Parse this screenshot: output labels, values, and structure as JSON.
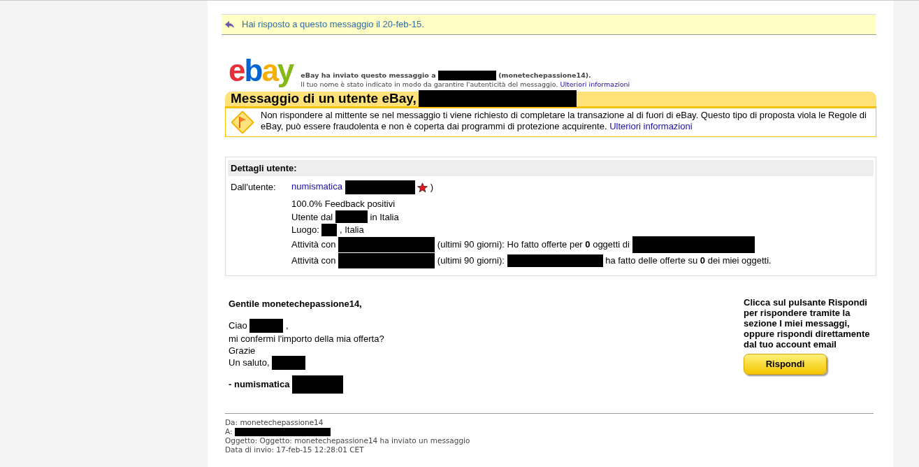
{
  "reply_notice": {
    "text": "Hai risposto a questo messaggio il 20-feb-15."
  },
  "header": {
    "logo": "ebay",
    "sent_parts": [
      {
        "kind": "text",
        "text": "eBay ha inviato questo messaggio a"
      },
      {
        "kind": "redacted"
      },
      {
        "kind": "text",
        "text": "(monetechepassione14)."
      }
    ],
    "notice": "Il tuo nome è stato indicato in modo da garantire l'autenticità del messaggio.",
    "notice_link": "Ulteriori informazioni"
  },
  "title_parts": [
    {
      "kind": "text",
      "text": "Messaggio di un utente eBay,"
    },
    {
      "kind": "redacted"
    }
  ],
  "warning": {
    "text": "Non rispondere al mittente se nel messaggio ti viene richiesto di completare la transazione al di fuori di eBay. Questo tipo di proposta viola le Regole di eBay, può essere fraudolenta e non è coperta dai programmi di protezione acquirente.",
    "link": "Ulteriori informazioni"
  },
  "user_details": {
    "heading": "Dettagli utente:",
    "label": "Dall'utente:",
    "rows": [
      [
        {
          "kind": "link",
          "text": "numismatica"
        },
        {
          "kind": "redacted"
        },
        {
          "kind": "star"
        },
        {
          "kind": "text",
          "text": ")"
        }
      ],
      [
        {
          "kind": "text",
          "text": "100.0% Feedback positivi"
        }
      ],
      [
        {
          "kind": "text",
          "text": "Utente dal"
        },
        {
          "kind": "redacted"
        },
        {
          "kind": "text",
          "text": "in Italia"
        }
      ],
      [
        {
          "kind": "text",
          "text": "Luogo:"
        },
        {
          "kind": "redacted"
        },
        {
          "kind": "text",
          "text": ", Italia"
        }
      ],
      [
        {
          "kind": "text",
          "text": "Attività con"
        },
        {
          "kind": "redacted"
        },
        {
          "kind": "text",
          "text": "(ultimi 90 giorni): Ho fatto offerte per **0** oggetti di"
        },
        {
          "kind": "redacted"
        }
      ],
      [
        {
          "kind": "text",
          "text": "Attività con"
        },
        {
          "kind": "redacted"
        },
        {
          "kind": "text",
          "text": "(ultimi 90 giorni):"
        },
        {
          "kind": "redacted"
        },
        {
          "kind": "text",
          "text": "ha fatto delle offerte su **0** dei miei oggetti."
        }
      ]
    ]
  },
  "message": {
    "greeting": "Gentile monetechepassione14,",
    "lines": [
      [
        {
          "kind": "text",
          "text": "Ciao"
        },
        {
          "kind": "redacted"
        },
        {
          "kind": "text",
          "text": ","
        }
      ],
      [
        {
          "kind": "text",
          "text": "mi confermi l'importo della mia offerta?"
        }
      ],
      [
        {
          "kind": "text",
          "text": "Grazie"
        }
      ],
      [
        {
          "kind": "text",
          "text": "Un saluto,"
        },
        {
          "kind": "redacted"
        }
      ]
    ],
    "signature": [
      {
        "kind": "text",
        "text": "- numismatica"
      },
      {
        "kind": "redacted"
      }
    ]
  },
  "reply_box": {
    "text": "Clicca sul pulsante Rispondi per rispondere tramite la sezione I miei messaggi, oppure rispondi direttamente dal tuo account email",
    "button": "Rispondi"
  },
  "footer": [
    [
      {
        "kind": "text",
        "text": "Da: monetechepassione14"
      }
    ],
    [
      {
        "kind": "text",
        "text": "A:"
      },
      {
        "kind": "redacted"
      }
    ],
    [
      {
        "kind": "text",
        "text": "Oggetto: Oggetto: monetechepassione14 ha inviato un messaggio"
      }
    ],
    [
      {
        "kind": "text",
        "text": "Data di invio: 17-feb-15 12:28:01 CET"
      }
    ]
  ]
}
